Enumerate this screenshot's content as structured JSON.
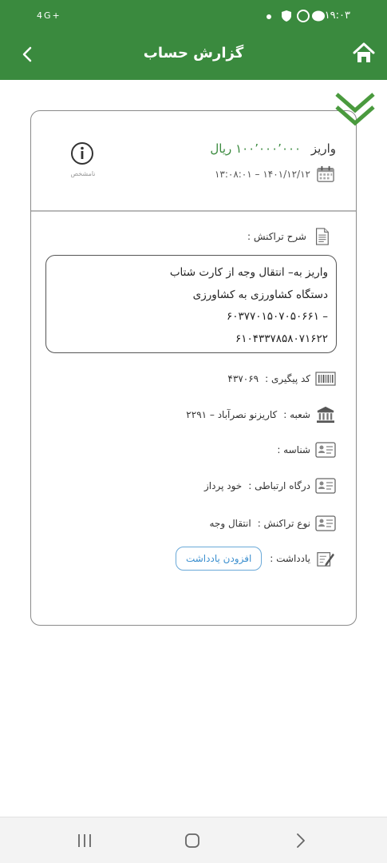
{
  "status_bar": {
    "signal_text": "4G+",
    "time": "۱۹:۰۳"
  },
  "header": {
    "title": "گزارش حساب"
  },
  "transaction": {
    "type": "واریز",
    "amount": "۱۰۰٬۰۰۰٬۰۰۰ ریال",
    "datetime": "۱۴۰۱/۱۲/۱۲ – ۱۳:۰۸:۰۱",
    "unknown_label": "نامشخص",
    "description_label": "شرح تراکنش :",
    "description": "واریز به– انتقال وجه از کارت شتاب\nدستگاه کشاورزی به کشاورزی\n– ۶۰۳۷۷۰۱۵۰۷۰۵۰۶۶۱\n۶۱۰۴۳۳۷۸۵۸۰۷۱۶۲۲"
  },
  "fields": {
    "tracking_label": "کد پیگیری :",
    "tracking_value": "۴۳۷۰۶۹",
    "branch_label": "شعبه :",
    "branch_value": "کاریزنو نصرآباد – ۲۲۹۱",
    "id_label": "شناسه :",
    "id_value": "",
    "gateway_label": "درگاه ارتباطی :",
    "gateway_value": "خود پرداز",
    "txn_type_label": "نوع تراکنش :",
    "txn_type_value": "انتقال وجه",
    "note_label": "یادداشت :",
    "add_note_button": "افزودن یادداشت"
  },
  "colors": {
    "header_green": "#3a8a3e",
    "chevron_green": "#4a9a3e",
    "link_blue": "#3b8fcf"
  },
  "icons": [
    "home-icon",
    "back-chevron-icon",
    "info-icon",
    "calendar-icon",
    "document-icon",
    "barcode-icon",
    "bank-icon",
    "id-card-icon",
    "pencil-note-icon",
    "double-chevron-down-icon"
  ]
}
